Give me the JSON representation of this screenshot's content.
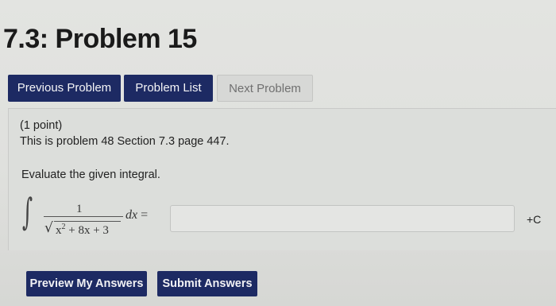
{
  "page": {
    "title": "7.3: Problem 15"
  },
  "nav": {
    "previous_label": "Previous Problem",
    "list_label": "Problem List",
    "next_label": "Next Problem"
  },
  "problem": {
    "points": "(1 point)",
    "description": "This is problem 48 Section 7.3 page 447.",
    "instruction": "Evaluate the given integral.",
    "integral_symbol": "∫",
    "numerator": "1",
    "sqrt_symbol": "√",
    "denominator_base": "x",
    "denominator_exponent": "2",
    "denominator_rest": " + 8x + 3",
    "differential": "dx",
    "equals": " =",
    "constant_suffix": "+C"
  },
  "answer": {
    "value": "",
    "placeholder": ""
  },
  "actions": {
    "preview_label": "Preview My Answers",
    "submit_label": "Submit Answers"
  }
}
